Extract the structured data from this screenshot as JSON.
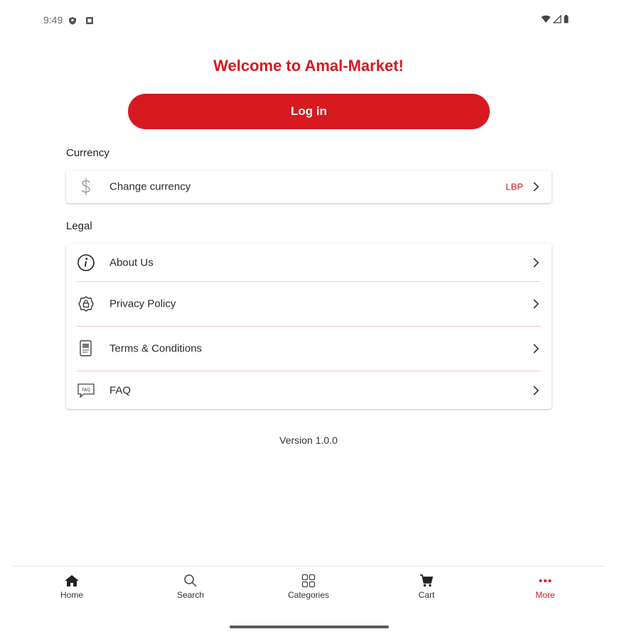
{
  "status_bar": {
    "time": "9:49"
  },
  "header": {
    "welcome": "Welcome to Amal-Market!"
  },
  "login_button": {
    "label": "Log in"
  },
  "currency_section": {
    "title": "Currency",
    "items": [
      {
        "label": "Change currency",
        "value": "LBP",
        "icon": "dollar-icon"
      }
    ]
  },
  "legal_section": {
    "title": "Legal",
    "items": [
      {
        "label": "About Us",
        "icon": "info-icon"
      },
      {
        "label": "Privacy Policy",
        "icon": "privacy-lock-icon"
      },
      {
        "label": "Terms & Conditions",
        "icon": "document-icon"
      },
      {
        "label": "FAQ",
        "icon": "faq-icon"
      }
    ]
  },
  "version": "Version 1.0.0",
  "bottom_nav": {
    "items": [
      {
        "label": "Home",
        "icon": "home-icon"
      },
      {
        "label": "Search",
        "icon": "search-icon"
      },
      {
        "label": "Categories",
        "icon": "categories-icon"
      },
      {
        "label": "Cart",
        "icon": "cart-icon"
      },
      {
        "label": "More",
        "icon": "more-icon",
        "active": true
      }
    ]
  },
  "colors": {
    "accent": "#d71920",
    "divider": "#f0c9cc"
  }
}
